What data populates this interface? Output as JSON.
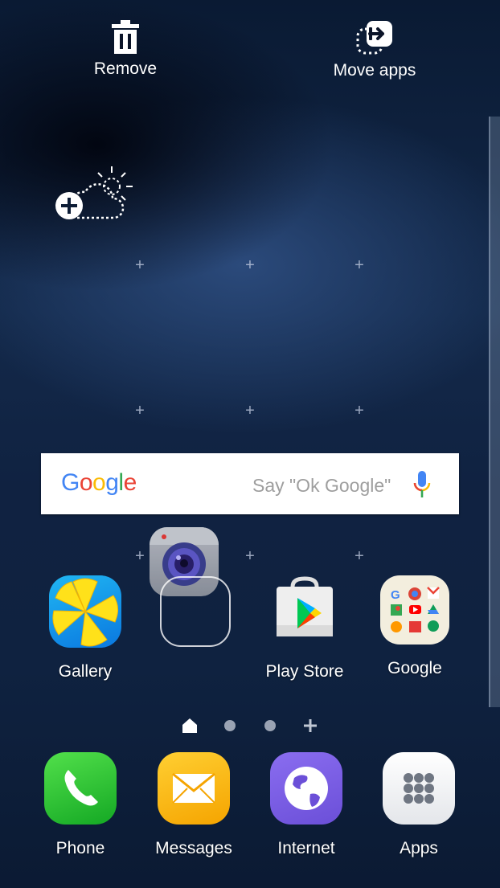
{
  "top_actions": {
    "remove_label": "Remove",
    "move_label": "Move apps"
  },
  "search": {
    "logo": "Google",
    "hint": "Say \"Ok Google\""
  },
  "home_apps": [
    {
      "label": "Gallery",
      "icon": "gallery-icon"
    },
    {
      "label": "",
      "icon": "camera-icon"
    },
    {
      "label": "Play Store",
      "icon": "play-store-icon"
    },
    {
      "label": "Google",
      "icon": "google-folder-icon"
    }
  ],
  "dock_apps": [
    {
      "label": "Phone",
      "icon": "phone-icon"
    },
    {
      "label": "Messages",
      "icon": "messages-icon"
    },
    {
      "label": "Internet",
      "icon": "internet-icon"
    },
    {
      "label": "Apps",
      "icon": "apps-grid-icon"
    }
  ],
  "page_indicators": [
    "home",
    "page",
    "page",
    "add"
  ],
  "colors": {
    "google_blue": "#4285F4",
    "google_red": "#EA4335",
    "google_yellow": "#FBBC05",
    "google_green": "#34A853"
  }
}
